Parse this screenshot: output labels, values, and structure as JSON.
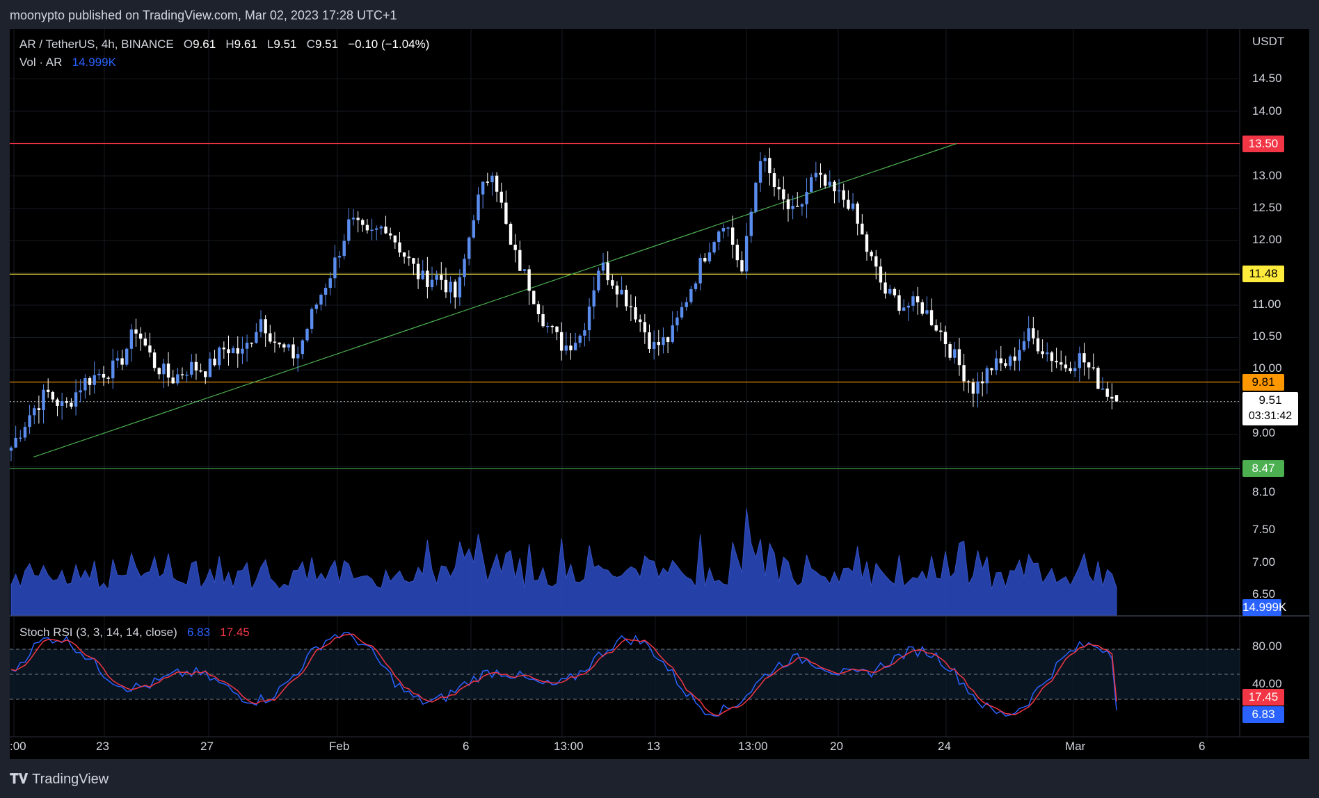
{
  "header": {
    "published": "moonypto published on TradingView.com, Mar 02, 2023 17:28 UTC+1"
  },
  "legend": {
    "symbol": "AR / TetherUS, 4h, BINANCE",
    "o_label": "O",
    "o": "9.61",
    "h_label": "H",
    "h": "9.61",
    "l_label": "L",
    "l": "9.51",
    "c_label": "C",
    "c": "9.51",
    "change": "−0.10 (−1.04%)",
    "vol_label": "Vol · AR",
    "vol_value": "14.999K",
    "stoch_label": "Stoch RSI (3, 3, 14, 14, close)",
    "stoch_k": "6.83",
    "stoch_d": "17.45"
  },
  "price_axis": {
    "currency": "USDT",
    "ticks": [
      "14.50",
      "14.00",
      "13.50",
      "13.00",
      "12.50",
      "12.00",
      "11.50",
      "11.00",
      "10.50",
      "10.00",
      "9.50",
      "9.00",
      "8.50",
      "8.10",
      "7.50",
      "7.00",
      "6.50"
    ]
  },
  "levels": [
    {
      "price": 13.5,
      "label": "13.50",
      "color": "#f23645",
      "text": "#ffffff"
    },
    {
      "price": 11.48,
      "label": "11.48",
      "color": "#ffeb3b",
      "text": "#000000"
    },
    {
      "price": 9.81,
      "label": "9.81",
      "color": "#ff9800",
      "text": "#000000"
    },
    {
      "price": 8.47,
      "label": "8.47",
      "color": "#4caf50",
      "text": "#ffffff"
    }
  ],
  "current_price": {
    "label": "9.51",
    "countdown": "03:31:42"
  },
  "stoch_axis": {
    "ticks": [
      "80.00",
      "40.00"
    ],
    "k_badge": "6.83",
    "d_badge": "17.45"
  },
  "time_axis": {
    "labels": [
      ":00",
      "23",
      "27",
      "Feb",
      "6",
      "13:00",
      "13",
      "13:00",
      "20",
      "24",
      "Mar",
      "6"
    ]
  },
  "footer": {
    "brand": "TradingView"
  },
  "colors": {
    "up": "#5b8def",
    "down": "#ffffff",
    "volume": "#2a47b8",
    "stoch_k": "#2962ff",
    "stoch_d": "#f23645",
    "trendline": "#4caf50"
  },
  "chart_data": {
    "type": "candlestick",
    "symbol": "AR / TetherUS",
    "interval": "4h",
    "currency": "USDT",
    "x_range": [
      "Jan 20, 2023",
      "Mar 02, 2023"
    ],
    "close_path": [
      [
        "Jan 20",
        8.8
      ],
      [
        "Jan 21",
        9.3
      ],
      [
        "Jan 21",
        9.65
      ],
      [
        "Jan 22",
        9.4
      ],
      [
        "Jan 22",
        9.8
      ],
      [
        "Jan 23",
        9.95
      ],
      [
        "Jan 24",
        10.05
      ],
      [
        "Jan 24",
        10.65
      ],
      [
        "Jan 25",
        10.1
      ],
      [
        "Jan 25",
        9.85
      ],
      [
        "Jan 26",
        10.05
      ],
      [
        "Jan 27",
        10.0
      ],
      [
        "Jan 27",
        10.35
      ],
      [
        "Jan 28",
        10.25
      ],
      [
        "Jan 29",
        10.8
      ],
      [
        "Jan 30",
        10.35
      ],
      [
        "Jan 31",
        10.2
      ],
      [
        "Feb 01",
        10.95
      ],
      [
        "Feb 01",
        11.55
      ],
      [
        "Feb 02",
        12.3
      ],
      [
        "Feb 03",
        12.05
      ],
      [
        "Feb 04",
        12.25
      ],
      [
        "Feb 05",
        11.8
      ],
      [
        "Feb 05",
        11.4
      ],
      [
        "Feb 06",
        11.45
      ],
      [
        "Feb 07",
        11.1
      ],
      [
        "Feb 07",
        12.5
      ],
      [
        "Feb 08",
        13.15
      ],
      [
        "Feb 08",
        11.9
      ],
      [
        "Feb 09",
        11.35
      ],
      [
        "Feb 10",
        10.7
      ],
      [
        "Feb 11",
        10.35
      ],
      [
        "Feb 11",
        10.55
      ],
      [
        "Feb 12",
        11.65
      ],
      [
        "Feb 13",
        11.3
      ],
      [
        "Feb 14",
        10.9
      ],
      [
        "Feb 14",
        10.35
      ],
      [
        "Feb 15",
        10.5
      ],
      [
        "Feb 16",
        11.2
      ],
      [
        "Feb 17",
        11.85
      ],
      [
        "Feb 17",
        12.35
      ],
      [
        "Feb 18",
        11.5
      ],
      [
        "Feb 18",
        13.35
      ],
      [
        "Feb 19",
        12.7
      ],
      [
        "Feb 19",
        12.35
      ],
      [
        "Feb 20",
        13.0
      ],
      [
        "Feb 20",
        12.75
      ],
      [
        "Feb 21",
        12.6
      ],
      [
        "Feb 22",
        11.85
      ],
      [
        "Feb 23",
        11.2
      ],
      [
        "Feb 23",
        11.0
      ],
      [
        "Feb 24",
        11.0
      ],
      [
        "Feb 25",
        10.65
      ],
      [
        "Feb 25",
        10.15
      ],
      [
        "Feb 26",
        9.7
      ],
      [
        "Feb 27",
        10.05
      ],
      [
        "Feb 27",
        10.1
      ],
      [
        "Feb 28",
        10.55
      ],
      [
        "Feb 28",
        10.3
      ],
      [
        "Mar 01",
        10.05
      ],
      [
        "Mar 01",
        10.2
      ],
      [
        "Mar 02",
        9.8
      ],
      [
        "Mar 02",
        9.51
      ]
    ],
    "last_candle": {
      "open": 9.61,
      "high": 9.61,
      "low": 9.51,
      "close": 9.51,
      "change": -0.1,
      "change_pct": -1.04
    },
    "horizontal_levels": [
      13.5,
      11.48,
      9.81,
      8.47
    ],
    "trendline": {
      "from": [
        "Jan 20",
        8.65
      ],
      "to": [
        "Feb 23",
        13.5
      ]
    },
    "volume_last": "14.999K",
    "stoch_rsi": {
      "params": "3, 3, 14, 14, close",
      "k": 6.83,
      "d": 17.45,
      "bands": [
        80,
        20
      ]
    },
    "y_axis": {
      "price_range": [
        6.3,
        14.8
      ]
    },
    "grid": true
  }
}
